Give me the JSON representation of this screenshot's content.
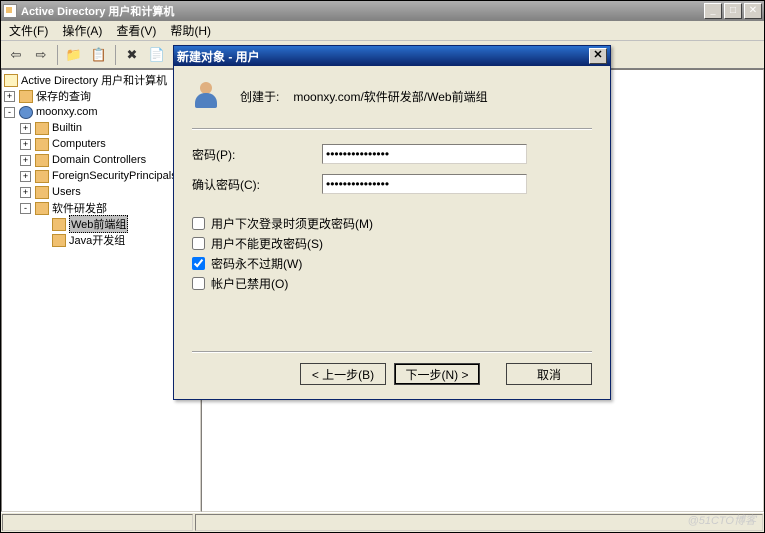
{
  "window": {
    "title": "Active Directory 用户和计算机",
    "min": "_",
    "max": "□",
    "close": "✕"
  },
  "menu": {
    "file": "文件(F)",
    "action": "操作(A)",
    "view": "查看(V)",
    "help": "帮助(H)"
  },
  "tree": {
    "root": "Active Directory 用户和计算机",
    "saved": "保存的查询",
    "domain": "moonxy.com",
    "builtin": "Builtin",
    "computers": "Computers",
    "dc": "Domain Controllers",
    "fsp": "ForeignSecurityPrincipals",
    "users": "Users",
    "dept": "软件研发部",
    "web": "Web前端组",
    "java": "Java开发组"
  },
  "dialog": {
    "title": "新建对象 - 用户",
    "close": "✕",
    "header_label": "创建于:",
    "header_value": "moonxy.com/软件研发部/Web前端组",
    "fields": {
      "password_label": "密码(P):",
      "confirm_label": "确认密码(C):",
      "password_value": "•••••••••••••••",
      "confirm_value": "•••••••••••••••"
    },
    "checks": {
      "must_change": "用户下次登录时须更改密码(M)",
      "cannot_change": "用户不能更改密码(S)",
      "never_expires": "密码永不过期(W)",
      "disabled": "帐户已禁用(O)"
    },
    "buttons": {
      "back": "< 上一步(B)",
      "next": "下一步(N) >",
      "cancel": "取消"
    }
  },
  "watermark": "@51CTO博客"
}
